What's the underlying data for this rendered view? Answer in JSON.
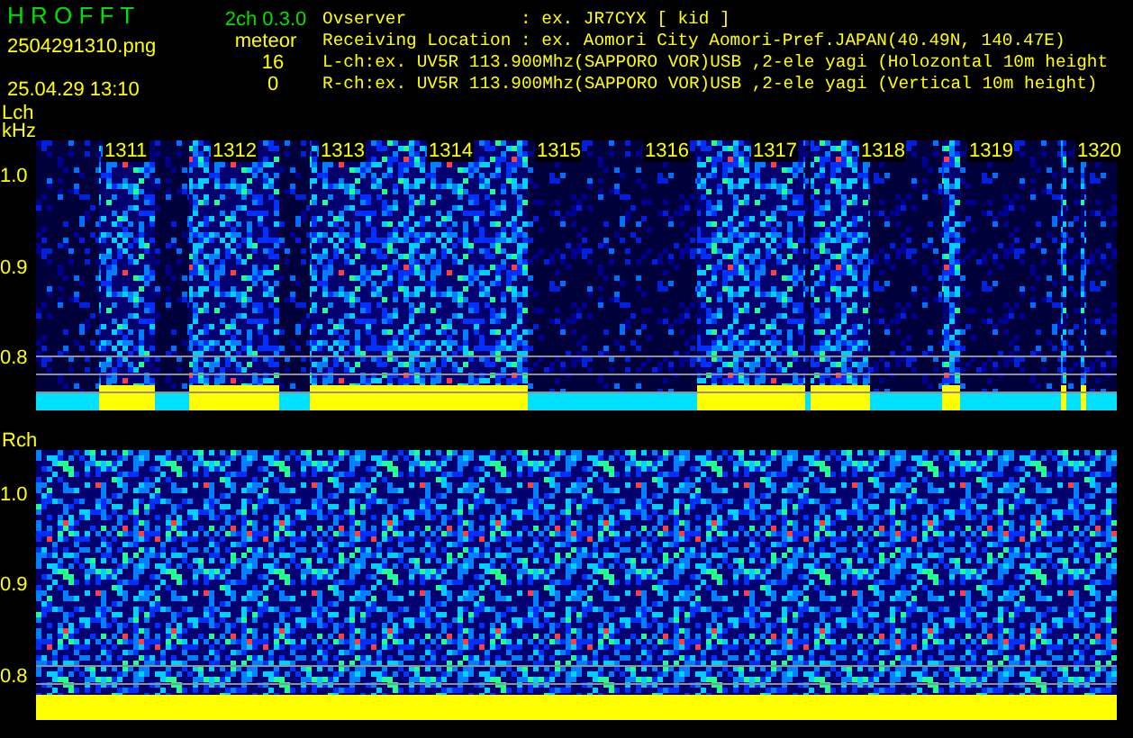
{
  "app": {
    "name": "H R O F F T",
    "version": "2ch 0.3.0"
  },
  "file_name": "2504291310.png",
  "timestamp": "25.04.29 13:10",
  "meteor": {
    "label": "meteor",
    "counts": [
      "16",
      "0"
    ]
  },
  "info": [
    {
      "label": "Ovserver",
      "value": ": ex. JR7CYX [ kid ]"
    },
    {
      "label": "Receiving Location",
      "value": ": ex. Aomori City Aomori-Pref.JAPAN(40.49N, 140.47E)"
    }
  ],
  "channel_lines": [
    "L-ch:ex. UV5R 113.900Mhz(SAPPORO VOR)USB ,2-ele yagi (Holozontal 10m height",
    "R-ch:ex. UV5R 113.900Mhz(SAPPORO VOR)USB ,2-ele yagi (Vertical 10m height)"
  ],
  "panels": [
    {
      "kind": "left",
      "label": "Lch",
      "unit": "kHz",
      "ticks": [
        "1.0",
        "0.9",
        "0.8"
      ],
      "time_labels": [
        "1311",
        "1312",
        "1313",
        "1314",
        "1315",
        "1316",
        "1317",
        "1318",
        "1319",
        "1320"
      ]
    },
    {
      "kind": "right",
      "label": "Rch",
      "ticks": [
        "1.0",
        "0.9",
        "0.8"
      ]
    }
  ]
}
